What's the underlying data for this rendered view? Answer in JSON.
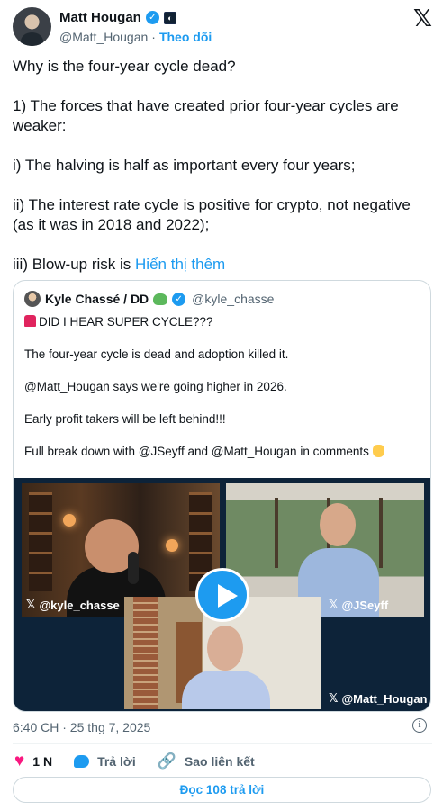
{
  "author": {
    "name": "Matt Hougan",
    "handle": "@Matt_Hougan",
    "separator": "·",
    "follow_label": "Theo dõi"
  },
  "post": {
    "paragraphs": [
      "Why is the four-year cycle dead?",
      "1) The forces that have created prior four-year cycles are weaker:",
      "i) The halving is half as important every four years;",
      "ii) The interest rate cycle is positive for crypto, not negative (as it was in 2018 and 2022);"
    ],
    "truncated_text": "iii) Blow-up risk is ",
    "show_more_label": "Hiển thị thêm"
  },
  "quote": {
    "name": "Kyle Chassé / DD",
    "handle": "@kyle_chasse",
    "lines": [
      "DID I HEAR SUPER CYCLE???",
      "The four-year cycle is dead and adoption killed it.",
      "@Matt_Hougan says we're going higher in 2026.",
      "Early profit takers will be left behind!!!",
      "Full break down with @JSeyff and @Matt_Hougan in comments"
    ],
    "video": {
      "labels": [
        "@kyle_chasse",
        "@JSeyff",
        "@Matt_Hougan"
      ],
      "x_glyph": "𝕏"
    }
  },
  "meta": {
    "timestamp": "6:40 CH · 25 thg 7, 2025",
    "info_glyph": "i"
  },
  "actions": {
    "likes": "1 N",
    "reply_label": "Trả lời",
    "copy_link_label": "Sao liên kết"
  },
  "read_replies_label": "Đọc 108 trả lời",
  "icons": {
    "x_logo": "𝕏",
    "heart": "♥",
    "link": "🔗",
    "verified": "✓"
  },
  "colors": {
    "accent": "#1d9bf0",
    "like": "#f91880",
    "secondary_text": "#536471"
  }
}
